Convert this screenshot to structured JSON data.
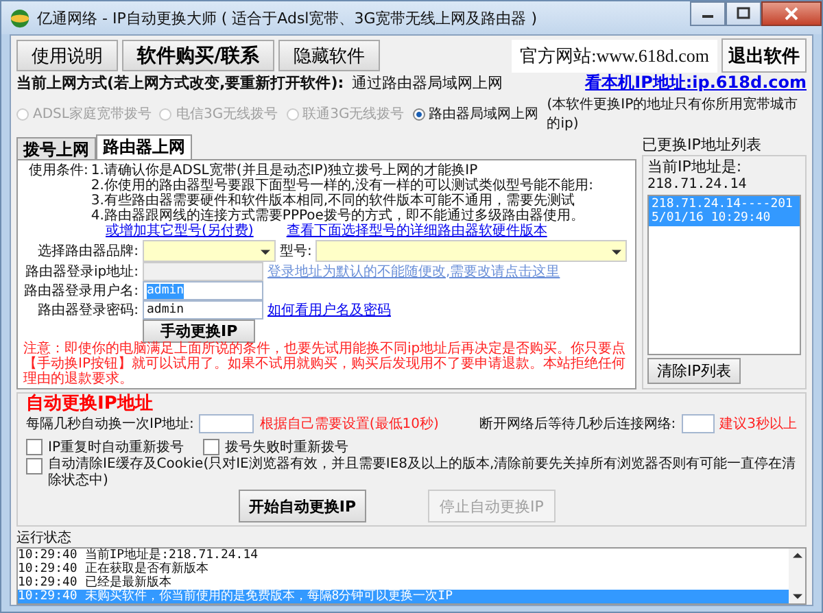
{
  "window": {
    "title": "亿通网络 - IP自动更换大师 ( 适合于Adsl宽带、3G宽带无线上网及路由器 )"
  },
  "top_buttons": [
    {
      "label": "使用说明",
      "emphasis": false
    },
    {
      "label": "软件购买/联系",
      "emphasis": true
    },
    {
      "label": "隐藏软件",
      "emphasis": false
    }
  ],
  "website": "官方网站:www.618d.com",
  "exit_button": "退出软件",
  "mode": {
    "label": "当前上网方式(若上网方式改变,要重新打开软件):",
    "value": "通过路由器局域网上网"
  },
  "ip_link": "看本机IP地址:ip.618d.com",
  "modes": [
    {
      "label": "ADSL家庭宽带拨号",
      "selected": false,
      "disabled": true
    },
    {
      "label": "电信3G无线拨号",
      "selected": false,
      "disabled": true
    },
    {
      "label": "联通3G无线拨号",
      "selected": false,
      "disabled": true
    },
    {
      "label": "路由器局域网上网",
      "selected": true,
      "disabled": false
    }
  ],
  "mode_note": "(本软件更换IP的地址只有你所用宽带城市的ip)",
  "tabs": [
    {
      "label": "拨号上网",
      "selected": false
    },
    {
      "label": "路由器上网",
      "selected": true
    }
  ],
  "conditions": {
    "label": "使用条件:",
    "items": [
      "1.请确认你是ADSL宽带(并且是动态IP)独立拨号上网的才能换IP",
      "2.你使用的路由器型号要跟下面型号一样的,没有一样的可以测试类似型号能不能用:",
      "3.有些路由器需要硬件和软件版本相同,不同的软件版本可能不通用，需要先测试",
      "4.路由器跟网线的连接方式需要PPPoe拨号的方式，即不能通过多级路由器使用。"
    ]
  },
  "links": [
    "或增加其它型号(另付费)",
    "查看下面选择型号的详细路由器软硬件版本"
  ],
  "brand": {
    "label": "选择路由器品牌:"
  },
  "model": {
    "label": "型号:"
  },
  "login_ip": {
    "label": "路由器登录ip地址:",
    "link": "登录地址为默认的不能随便改,需要改请点击这里"
  },
  "username": {
    "label": "路由器登录用户名:",
    "value": "admin"
  },
  "password": {
    "label": "路由器登录密码:",
    "value": "admin",
    "link": "如何看用户名及密码"
  },
  "manual_button": "手动更换IP",
  "notice": "注意：即使你的电脑满足上面所说的条件，也要先试用能换不同ip地址后再决定是否购买。你只要点【手动换IP按钮】就可以试用了。如果不试用就购买，购买后发现用不了要申请退款。本站拒绝任何理由的退款要求。",
  "history": {
    "title": "已更换IP地址列表",
    "current_label": "当前IP地址是:",
    "current_ip": "218.71.24.14",
    "entries": [
      {
        "text": "218.71.24.14----2015/01/16 10:29:40",
        "selected": true
      }
    ],
    "clear_button": "清除IP列表"
  },
  "auto": {
    "title": "自动更换IP地址",
    "interval_label": "每隔几秒自动换一次IP地址:",
    "interval_hint": "根据自己需要设置(最低10秒)",
    "wait_label": "断开网络后等待几秒后连接网络:",
    "wait_hint": "建议3秒以上",
    "options": [
      {
        "label": "IP重复时自动重新拨号",
        "checked": false
      },
      {
        "label": "拨号失败时重新拨号",
        "checked": false
      },
      {
        "label": "自动清除IE缓存及Cookie(只对IE浏览器有效，并且需要IE8及以上的版本,清除前要先关掉所有浏览器否则有可能一直停在清除状态中)",
        "checked": false
      }
    ],
    "start_button": {
      "label": "开始自动更换IP",
      "disabled": false
    },
    "stop_button": {
      "label": "停止自动更换IP",
      "disabled": true
    }
  },
  "log": {
    "title": "运行状态",
    "entries": [
      {
        "time": "10:29:40",
        "message": "当前IP地址是:218.71.24.14",
        "selected": false
      },
      {
        "time": "10:29:40",
        "message": "正在获取是否有新版本",
        "selected": false
      },
      {
        "time": "10:29:40",
        "message": "已经是最新版本",
        "selected": false
      },
      {
        "time": "10:29:40",
        "message": "未购买软件，你当前使用的是免费版本，每隔8分钟可以更换一次IP",
        "selected": true
      }
    ]
  }
}
